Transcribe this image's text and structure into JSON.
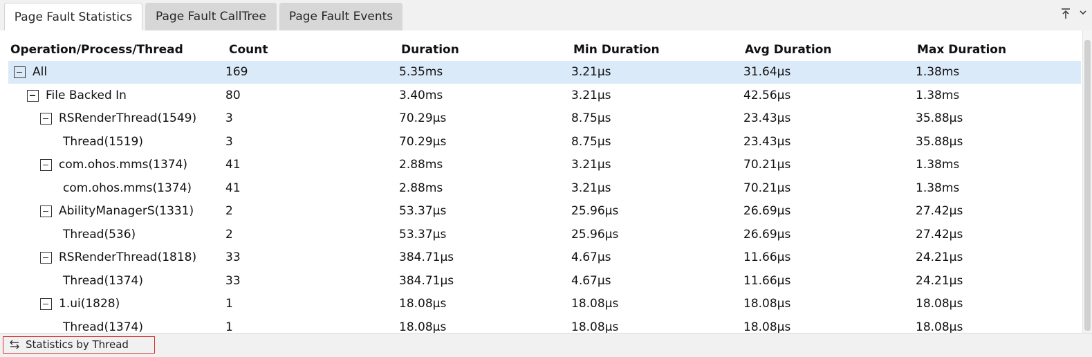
{
  "tabs": [
    {
      "label": "Page Fault Statistics",
      "active": true
    },
    {
      "label": "Page Fault CallTree",
      "active": false
    },
    {
      "label": "Page Fault Events",
      "active": false
    }
  ],
  "toolbar_icons": [
    "pin-to-top-icon",
    "chevron-down-icon"
  ],
  "columns": {
    "name": "Operation/Process/Thread",
    "count": "Count",
    "duration": "Duration",
    "min": "Min Duration",
    "avg": "Avg Duration",
    "max": "Max Duration"
  },
  "rows": [
    {
      "name": "All",
      "level": 0,
      "expanded": true,
      "selected": true,
      "count": "169",
      "duration": "5.35ms",
      "min": "3.21μs",
      "avg": "31.64μs",
      "max": "1.38ms"
    },
    {
      "name": "File Backed In",
      "level": 1,
      "expanded": true,
      "count": "80",
      "duration": "3.40ms",
      "min": "3.21μs",
      "avg": "42.56μs",
      "max": "1.38ms"
    },
    {
      "name": "RSRenderThread(1549)",
      "level": 2,
      "expanded": true,
      "count": "3",
      "duration": "70.29μs",
      "min": "8.75μs",
      "avg": "23.43μs",
      "max": "35.88μs"
    },
    {
      "name": "Thread(1519)",
      "level": 3,
      "leaf": true,
      "count": "3",
      "duration": "70.29μs",
      "min": "8.75μs",
      "avg": "23.43μs",
      "max": "35.88μs"
    },
    {
      "name": "com.ohos.mms(1374)",
      "level": 2,
      "expanded": true,
      "count": "41",
      "duration": "2.88ms",
      "min": "3.21μs",
      "avg": "70.21μs",
      "max": "1.38ms"
    },
    {
      "name": "com.ohos.mms(1374)",
      "level": 3,
      "leaf": true,
      "count": "41",
      "duration": "2.88ms",
      "min": "3.21μs",
      "avg": "70.21μs",
      "max": "1.38ms"
    },
    {
      "name": "AbilityManagerS(1331)",
      "level": 2,
      "expanded": true,
      "count": "2",
      "duration": "53.37μs",
      "min": "25.96μs",
      "avg": "26.69μs",
      "max": "27.42μs"
    },
    {
      "name": "Thread(536)",
      "level": 3,
      "leaf": true,
      "count": "2",
      "duration": "53.37μs",
      "min": "25.96μs",
      "avg": "26.69μs",
      "max": "27.42μs"
    },
    {
      "name": "RSRenderThread(1818)",
      "level": 2,
      "expanded": true,
      "count": "33",
      "duration": "384.71μs",
      "min": "4.67μs",
      "avg": "11.66μs",
      "max": "24.21μs"
    },
    {
      "name": "Thread(1374)",
      "level": 3,
      "leaf": true,
      "count": "33",
      "duration": "384.71μs",
      "min": "4.67μs",
      "avg": "11.66μs",
      "max": "24.21μs"
    },
    {
      "name": "1.ui(1828)",
      "level": 2,
      "expanded": true,
      "count": "1",
      "duration": "18.08μs",
      "min": "18.08μs",
      "avg": "18.08μs",
      "max": "18.08μs"
    },
    {
      "name": "Thread(1374)",
      "level": 3,
      "leaf": true,
      "count": "1",
      "duration": "18.08μs",
      "min": "18.08μs",
      "avg": "18.08μs",
      "max": "18.08μs"
    }
  ],
  "bottom": {
    "stats_label": "Statistics by Thread"
  }
}
